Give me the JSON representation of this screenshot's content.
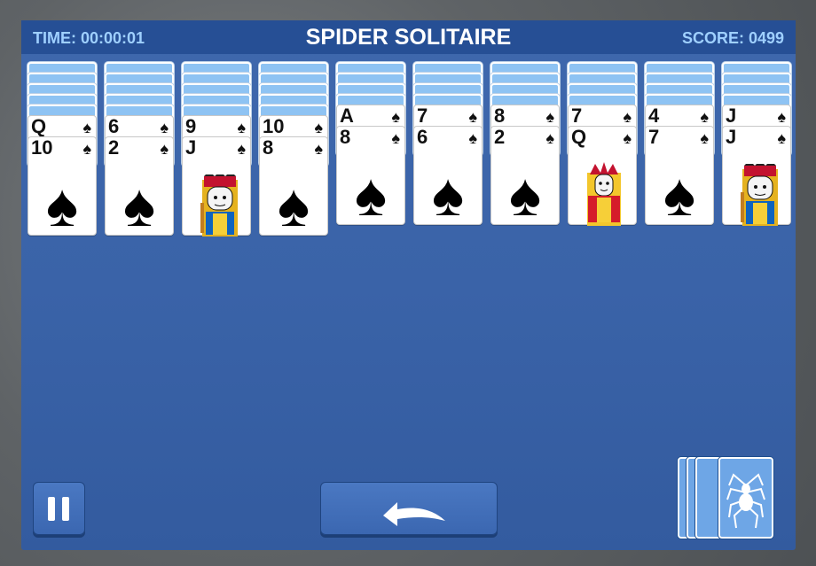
{
  "header": {
    "time_label": "TIME: 00:00:01",
    "title": "SPIDER SOLITAIRE",
    "score_label": "SCORE: 0499"
  },
  "columns": [
    {
      "hidden": 5,
      "cards": [
        {
          "rank": "Q",
          "suit": "♠"
        },
        {
          "rank": "10",
          "suit": "♠"
        }
      ]
    },
    {
      "hidden": 5,
      "cards": [
        {
          "rank": "6",
          "suit": "♠"
        },
        {
          "rank": "2",
          "suit": "♠"
        }
      ]
    },
    {
      "hidden": 5,
      "cards": [
        {
          "rank": "9",
          "suit": "♠"
        },
        {
          "rank": "J",
          "suit": "♠"
        }
      ]
    },
    {
      "hidden": 5,
      "cards": [
        {
          "rank": "10",
          "suit": "♠"
        },
        {
          "rank": "8",
          "suit": "♠"
        }
      ]
    },
    {
      "hidden": 4,
      "cards": [
        {
          "rank": "A",
          "suit": "♠"
        },
        {
          "rank": "8",
          "suit": "♠"
        }
      ]
    },
    {
      "hidden": 4,
      "cards": [
        {
          "rank": "7",
          "suit": "♠"
        },
        {
          "rank": "6",
          "suit": "♠"
        }
      ]
    },
    {
      "hidden": 4,
      "cards": [
        {
          "rank": "8",
          "suit": "♠"
        },
        {
          "rank": "2",
          "suit": "♠"
        }
      ]
    },
    {
      "hidden": 4,
      "cards": [
        {
          "rank": "7",
          "suit": "♠"
        },
        {
          "rank": "Q",
          "suit": "♠"
        }
      ]
    },
    {
      "hidden": 4,
      "cards": [
        {
          "rank": "4",
          "suit": "♠"
        },
        {
          "rank": "7",
          "suit": "♠"
        }
      ]
    },
    {
      "hidden": 4,
      "cards": [
        {
          "rank": "J",
          "suit": "♠"
        },
        {
          "rank": "J",
          "suit": "♠"
        }
      ]
    }
  ],
  "controls": {
    "pause_icon": "pause-icon",
    "undo_icon": "undo-arrow-icon",
    "stock_icon": "spider-icon",
    "stock_piles": 4
  },
  "colors": {
    "board": "#3a63a8",
    "card_back": "#8ec3f3",
    "accent_text": "#9fd0ff"
  }
}
